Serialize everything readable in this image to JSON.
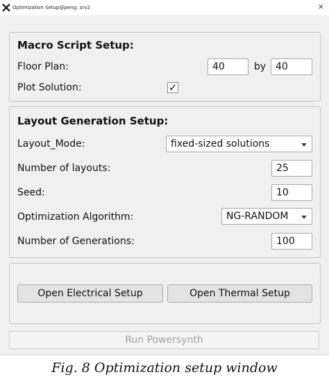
{
  "window": {
    "title": "Optimization Setup@peng: srv2",
    "close_label": "×"
  },
  "macro": {
    "title": "Macro Script Setup:",
    "floor_plan_label": "Floor Plan:",
    "floor_plan_width": "40",
    "by_label": "by",
    "floor_plan_height": "40",
    "plot_solution_label": "Plot Solution:",
    "plot_solution_checked": "✓"
  },
  "layout": {
    "title": "Layout Generation Setup:",
    "mode_label": "Layout_Mode:",
    "mode_value": "fixed-sized solutions",
    "num_layouts_label": "Number of layouts:",
    "num_layouts_value": "25",
    "seed_label": "Seed:",
    "seed_value": "10",
    "algorithm_label": "Optimization Algorithm:",
    "algorithm_value": "NG-RANDOM",
    "generations_label": "Number of Generations:",
    "generations_value": "100"
  },
  "buttons": {
    "electrical": "Open Electrical Setup",
    "thermal": "Open Thermal Setup",
    "run": "Run Powersynth"
  },
  "caption": "Fig. 8 Optimization setup window"
}
